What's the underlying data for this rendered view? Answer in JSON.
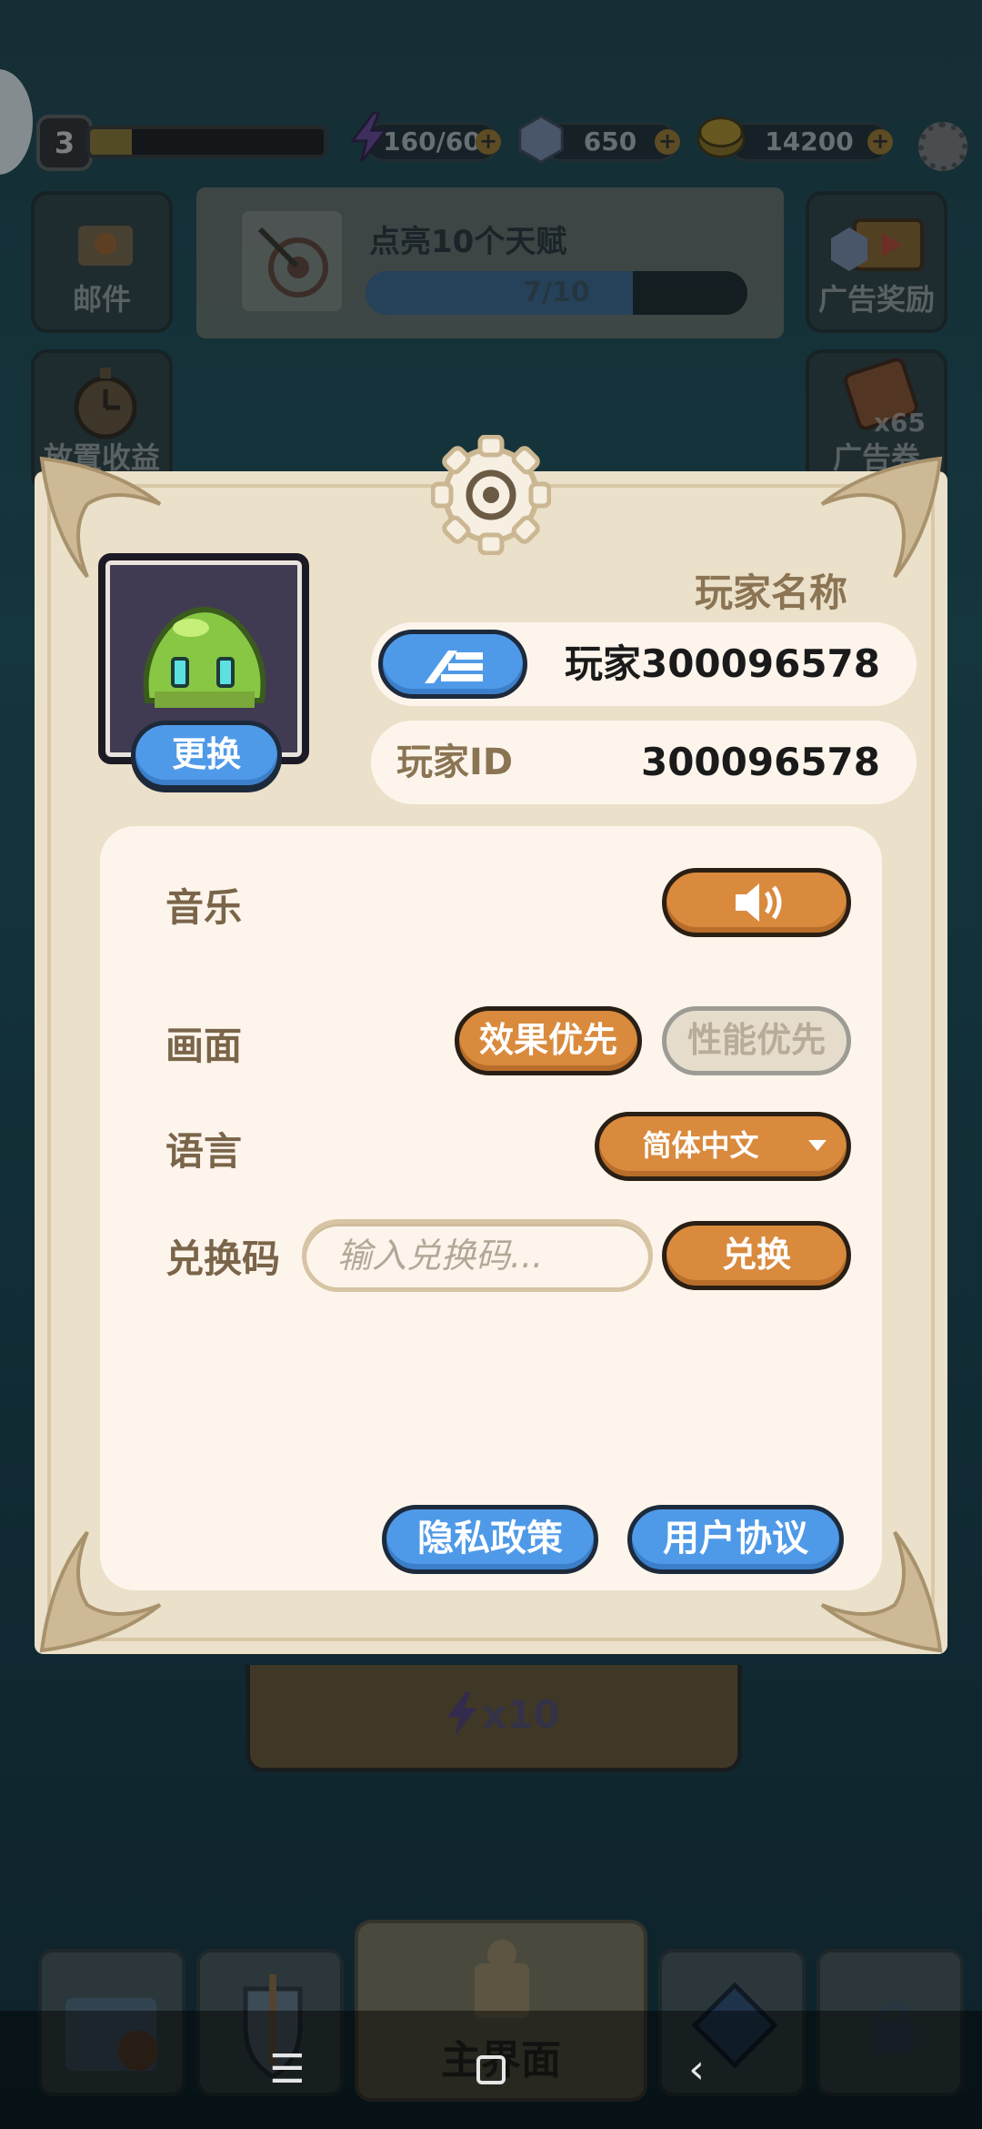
{
  "hud": {
    "level": "3",
    "xp_progress": 0.18,
    "energy": "160/60",
    "gems": "650",
    "coins": "14200",
    "settings_icon": "gear-icon"
  },
  "side_buttons": {
    "mail": "邮件",
    "ad_reward": "广告奖励",
    "idle_income": "放置收益",
    "ad_ticket": "广告券",
    "ad_ticket_count": "x65"
  },
  "quest": {
    "title": "点亮10个天赋",
    "progress_text": "7/10",
    "progress": 0.7
  },
  "energy_card": {
    "cost": "x10"
  },
  "bottom_nav": {
    "main_label": "主界面"
  },
  "dialog": {
    "name_label": "玩家名称",
    "player_name": "玩家300096578",
    "id_label": "玩家ID",
    "player_id": "300096578",
    "swap_button": "更换",
    "music_label": "音乐",
    "graphics_label": "画面",
    "graphics_quality": "效果优先",
    "graphics_performance": "性能优先",
    "language_label": "语言",
    "language_value": "简体中文",
    "redeem_label": "兑换码",
    "redeem_placeholder": "输入兑换码...",
    "redeem_button": "兑换",
    "privacy_button": "隐私政策",
    "terms_button": "用户协议"
  },
  "colors": {
    "panel": "#ebe0c9",
    "inner": "#fdf5ec",
    "orange": "#d98a3d",
    "blue": "#4f9ae8",
    "label_brown": "#7a654a"
  }
}
